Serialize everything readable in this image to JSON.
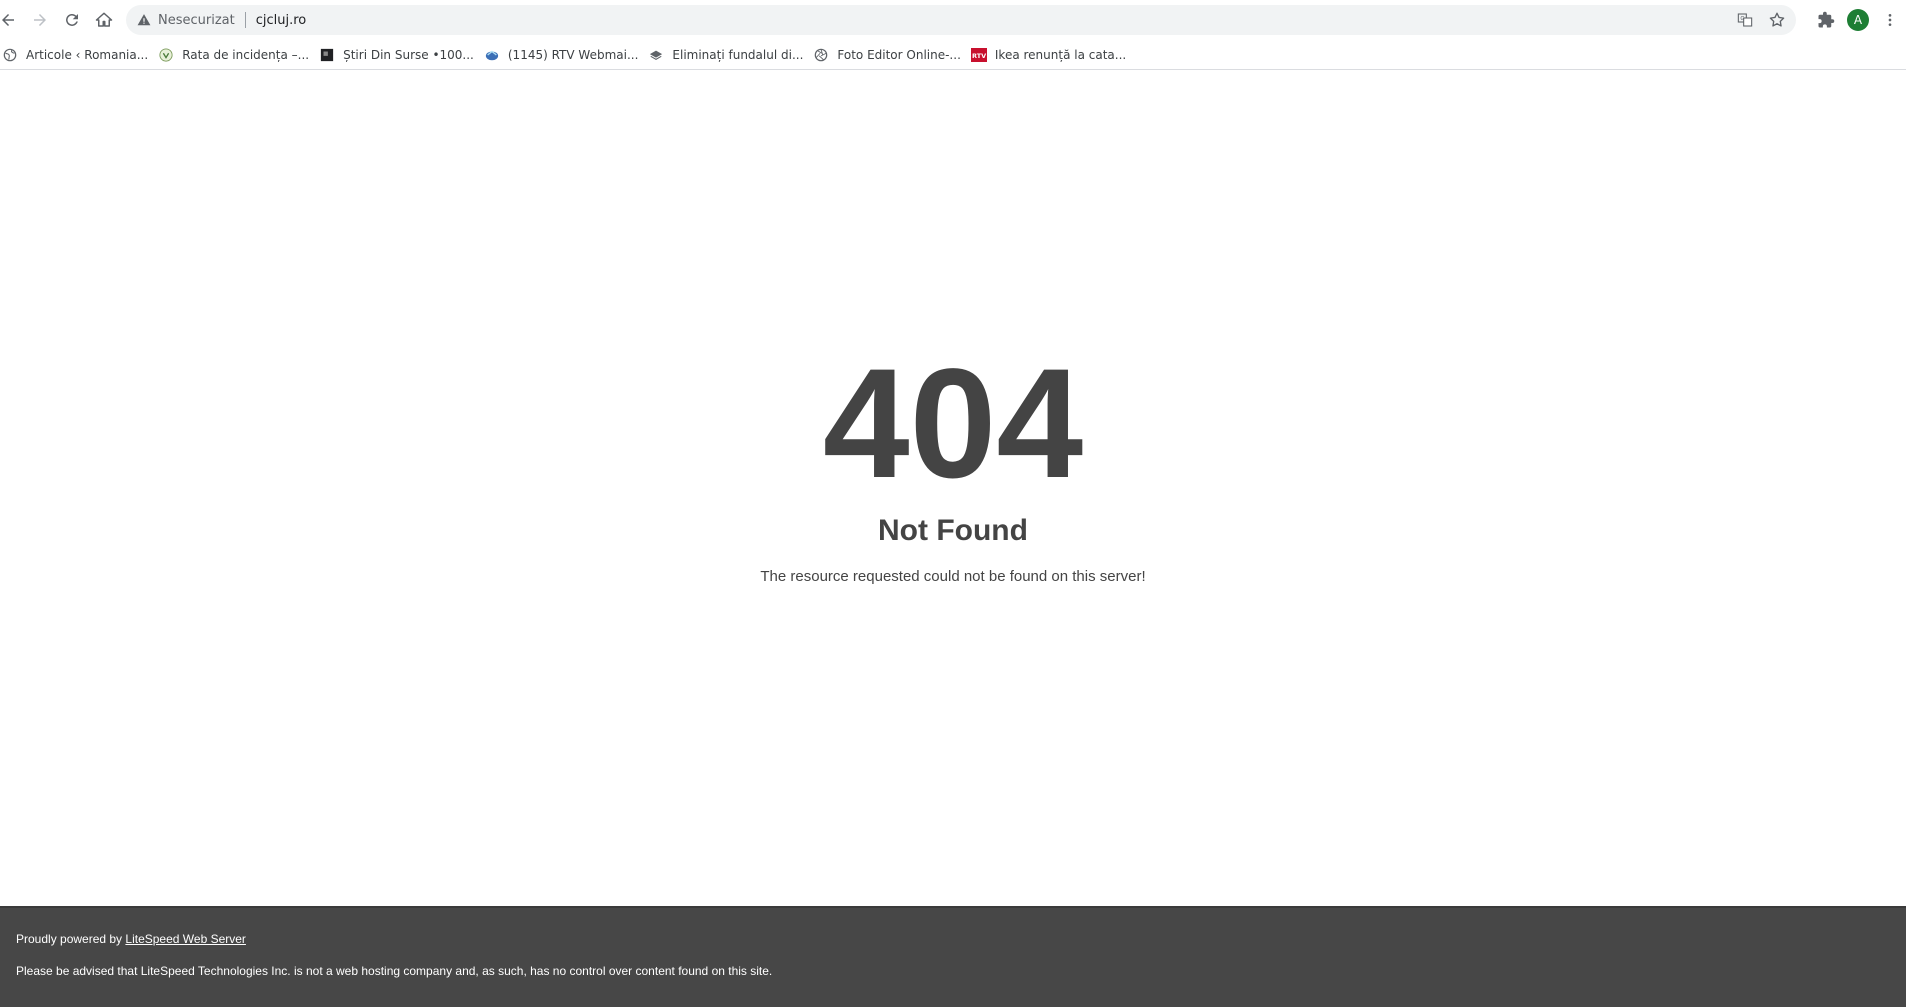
{
  "browser": {
    "security_label": "Nesecurizat",
    "url": "cjcluj.ro",
    "avatar_letter": "A",
    "icons": {
      "back": "arrow-left-icon",
      "forward": "arrow-right-icon",
      "reload": "reload-icon",
      "home": "home-icon",
      "warning": "warning-icon",
      "translate": "translate-icon",
      "bookmark": "star-icon",
      "extensions": "puzzle-icon",
      "menu": "kebab-menu-icon"
    }
  },
  "bookmarks": [
    {
      "label": "Articole ‹ Romania...",
      "icon": "globe-icon"
    },
    {
      "label": "Rata de incidența –...",
      "icon": "shield-icon"
    },
    {
      "label": "Știri Din Surse •100...",
      "icon": "square-icon"
    },
    {
      "label": "(1145) RTV Webmai...",
      "icon": "mail-icon"
    },
    {
      "label": "Eliminați fundalul di...",
      "icon": "layers-icon"
    },
    {
      "label": "Foto Editor Online-...",
      "icon": "aperture-icon"
    },
    {
      "label": "Ikea renunță la cata...",
      "icon": "rtv-logo-icon"
    }
  ],
  "page": {
    "code": "404",
    "title": "Not Found",
    "message": "The resource requested could not be found on this server!"
  },
  "footer": {
    "powered_prefix": "Proudly powered by ",
    "powered_link": "LiteSpeed Web Server",
    "disclaimer": "Please be advised that LiteSpeed Technologies Inc. is not a web hosting company and, as such, has no control over content found on this site."
  },
  "colors": {
    "text_dark": "#444444",
    "footer_bg": "#474747",
    "avatar_bg": "#1e7e34",
    "omnibox_bg": "#f1f3f4"
  }
}
